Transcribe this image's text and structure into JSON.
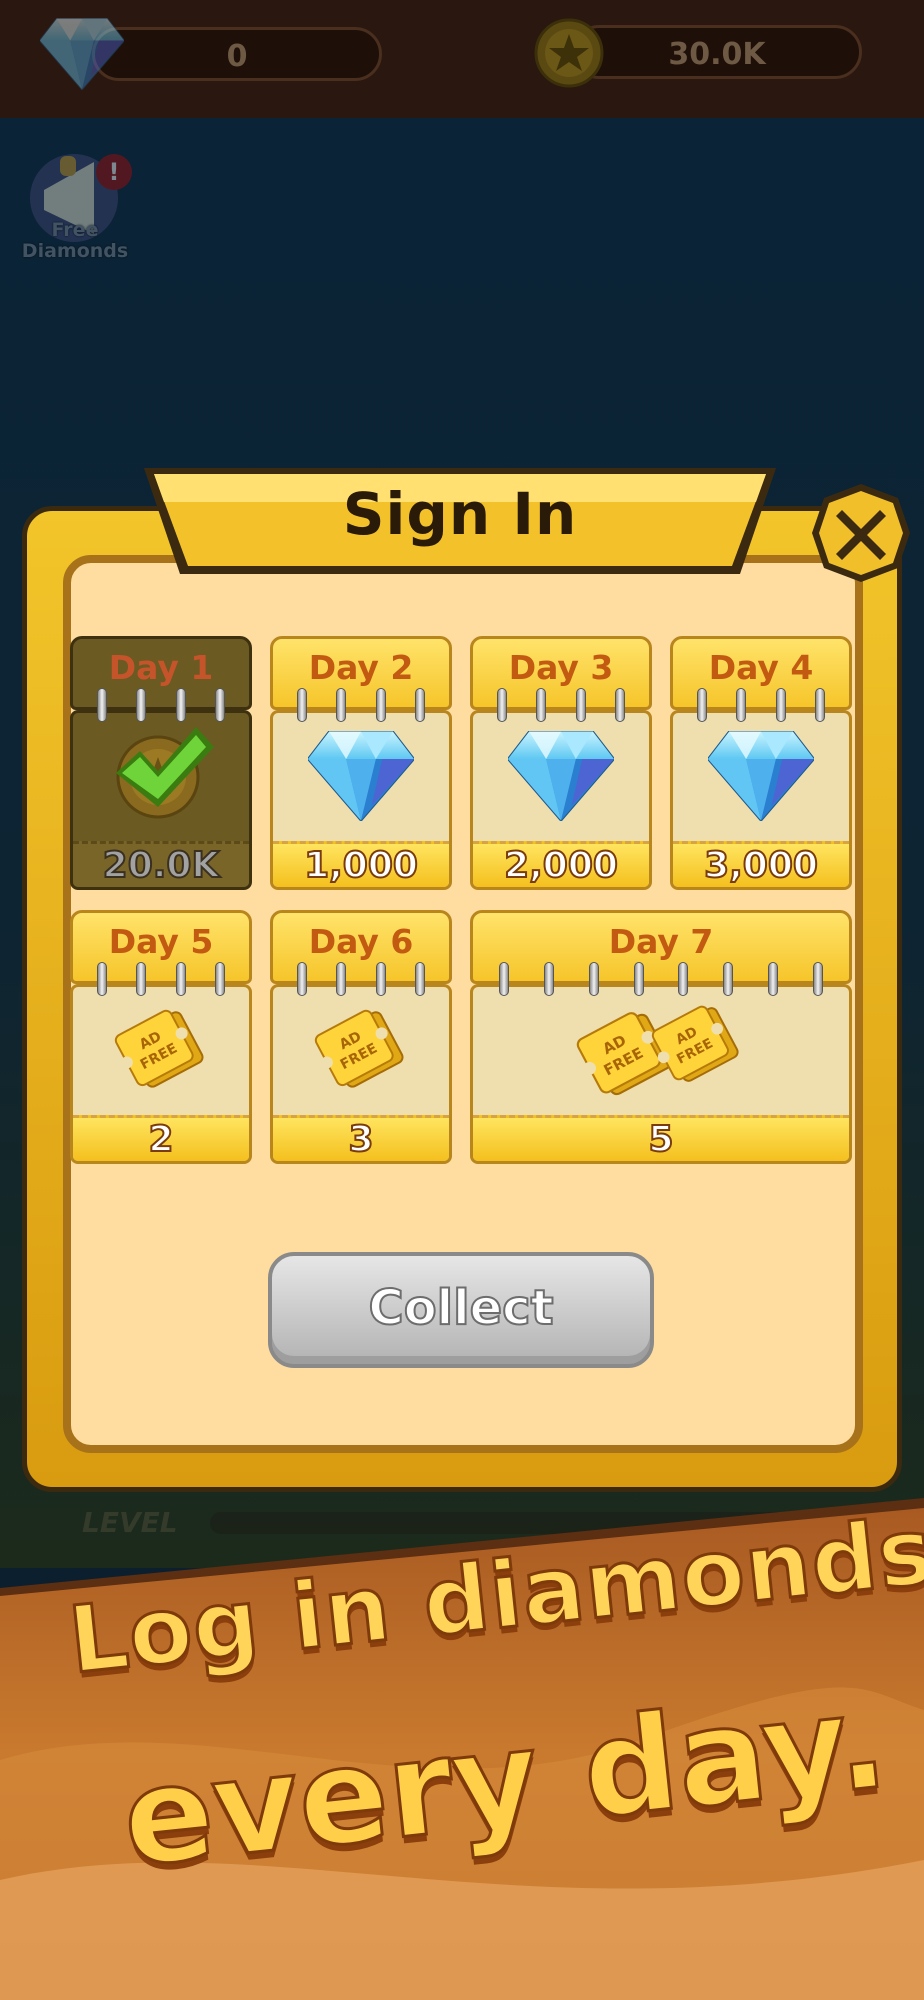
{
  "top_bar": {
    "diamonds": "0",
    "coins": "30.0K",
    "diamond_icon": "diamond-icon",
    "coin_icon": "star-coin-icon"
  },
  "free_diamonds": {
    "label_line1": "Free",
    "label_line2": "Diamonds"
  },
  "background": {
    "level_label": "LEVEL"
  },
  "dialog": {
    "title": "Sign In",
    "close_icon": "close-x-icon",
    "collect_label": "Collect",
    "days": [
      {
        "label": "Day 1",
        "reward": "20.0K",
        "reward_icon": "coin-icon",
        "claimed": true
      },
      {
        "label": "Day 2",
        "reward": "1,000",
        "reward_icon": "diamond-icon",
        "claimed": false
      },
      {
        "label": "Day 3",
        "reward": "2,000",
        "reward_icon": "diamond-icon",
        "claimed": false
      },
      {
        "label": "Day 4",
        "reward": "3,000",
        "reward_icon": "diamond-icon",
        "claimed": false
      },
      {
        "label": "Day 5",
        "reward": "2",
        "reward_icon": "ad-free-ticket-icon",
        "claimed": false
      },
      {
        "label": "Day 6",
        "reward": "3",
        "reward_icon": "ad-free-ticket-icon",
        "claimed": false
      },
      {
        "label": "Day 7",
        "reward": "5",
        "reward_icon": "ad-free-ticket-icon",
        "claimed": false
      }
    ],
    "ticket_text": "AD FREE"
  },
  "promo": {
    "line1": "Log in diamonds",
    "line2": "every day."
  },
  "colors": {
    "gold": "#f6c52a",
    "frame_dark": "#3b2a10",
    "panel": "#ffdda0",
    "day_text": "#c35a12",
    "desert": "#c97a2e"
  }
}
